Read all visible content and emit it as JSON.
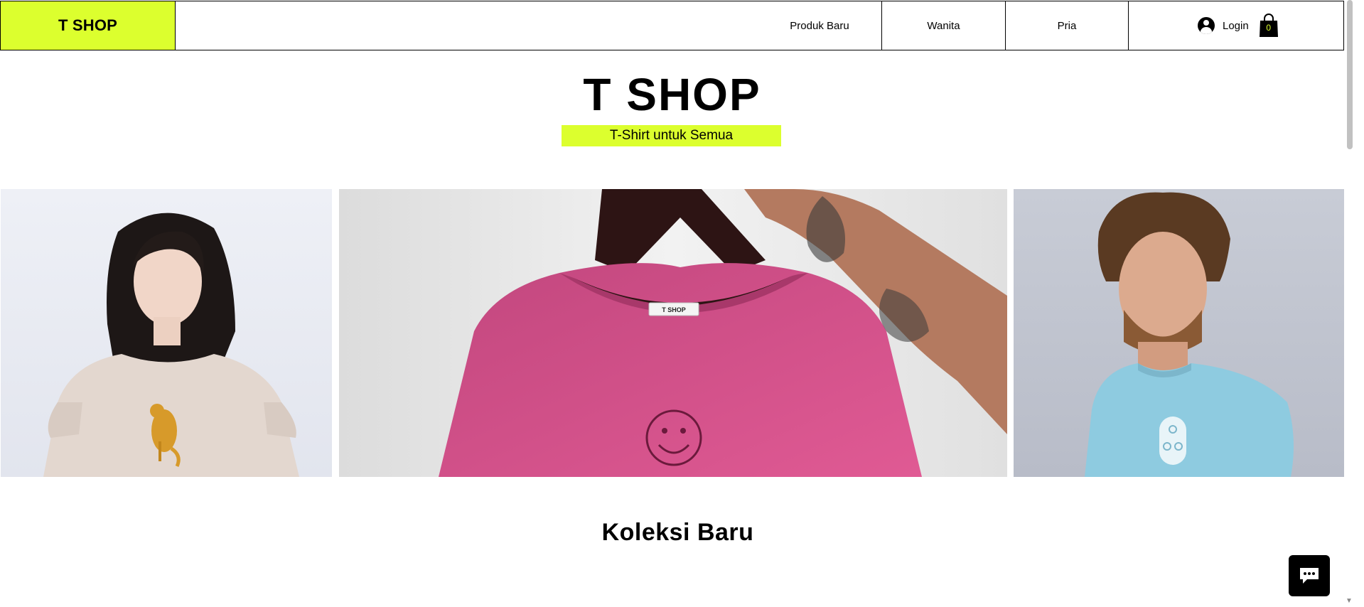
{
  "header": {
    "logo": "T SHOP",
    "nav": [
      "Produk Baru",
      "Wanita",
      "Pria"
    ],
    "login_label": "Login",
    "cart_count": "0"
  },
  "hero": {
    "title": "T SHOP",
    "tagline": "T-Shirt untuk Semua"
  },
  "images": [
    {
      "icon": "woman-beige-tshirt-leopard-photo"
    },
    {
      "icon": "pink-tshirt-on-hanger-photo",
      "label": "T SHOP"
    },
    {
      "icon": "man-blue-tshirt-photo"
    }
  ],
  "section": {
    "title": "Koleksi Baru"
  },
  "colors": {
    "accent": "#dcff2e",
    "text": "#000000",
    "bg": "#ffffff"
  }
}
